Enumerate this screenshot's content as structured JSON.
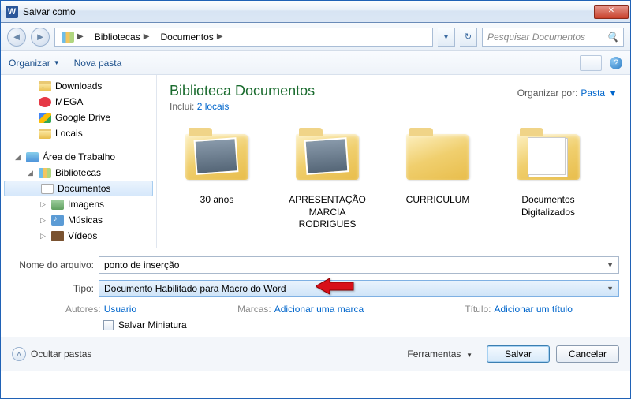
{
  "window": {
    "title": "Salvar como"
  },
  "nav": {
    "breadcrumb": [
      "Bibliotecas",
      "Documentos"
    ],
    "search_placeholder": "Pesquisar Documentos"
  },
  "toolbar": {
    "organize": "Organizar",
    "new_folder": "Nova pasta"
  },
  "sidebar": {
    "items": [
      {
        "label": "Downloads",
        "icon": "dl",
        "level": 1
      },
      {
        "label": "MEGA",
        "icon": "cloud",
        "level": 1
      },
      {
        "label": "Google Drive",
        "icon": "gd",
        "level": 1
      },
      {
        "label": "Locais",
        "icon": "f",
        "level": 1
      },
      {
        "label": "Área de Trabalho",
        "icon": "desktop",
        "level": 0,
        "exp": true
      },
      {
        "label": "Bibliotecas",
        "icon": "lib",
        "level": 1,
        "exp": true
      },
      {
        "label": "Documentos",
        "icon": "doc",
        "level": 2,
        "selected": true
      },
      {
        "label": "Imagens",
        "icon": "img",
        "level": 2
      },
      {
        "label": "Músicas",
        "icon": "mus",
        "level": 2
      },
      {
        "label": "Vídeos",
        "icon": "vid",
        "level": 2
      }
    ]
  },
  "content": {
    "heading": "Biblioteca Documentos",
    "subtitle_prefix": "Inclui: ",
    "subtitle_link": "2 locais",
    "arrange_label": "Organizar por:",
    "arrange_value": "Pasta",
    "folders": [
      {
        "name": "30 anos",
        "type": "photo"
      },
      {
        "name": "APRESENTAÇÃO MARCIA RODRIGUES",
        "type": "photo"
      },
      {
        "name": "CURRICULUM",
        "type": "plain"
      },
      {
        "name": "Documentos Digitalizados",
        "type": "docs"
      }
    ]
  },
  "form": {
    "filename_label": "Nome do arquivo:",
    "filename_value": "ponto de inserção",
    "type_label": "Tipo:",
    "type_value": "Documento Habilitado para Macro do Word",
    "authors_label": "Autores:",
    "authors_value": "Usuario",
    "tags_label": "Marcas:",
    "tags_value": "Adicionar uma marca",
    "title_label": "Título:",
    "title_value": "Adicionar um título",
    "thumbnail_label": "Salvar Miniatura"
  },
  "bottom": {
    "hide_folders": "Ocultar pastas",
    "tools": "Ferramentas",
    "save": "Salvar",
    "cancel": "Cancelar"
  }
}
